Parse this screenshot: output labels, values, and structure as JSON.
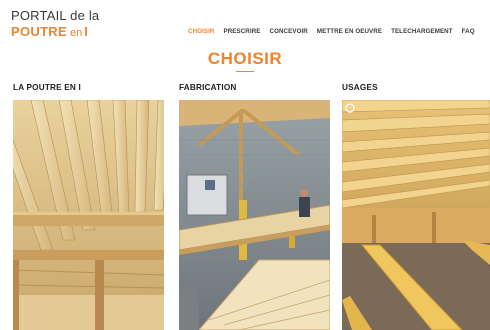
{
  "logo": {
    "line1": "PORTAIL de la",
    "bold": "POUTRE",
    "small": "en",
    "letter": "I"
  },
  "nav": {
    "items": [
      {
        "label": "CHOISIR",
        "active": true
      },
      {
        "label": "PRESCRIRE"
      },
      {
        "label": "CONCEVOIR"
      },
      {
        "label": "METTRE EN OEUVRE"
      },
      {
        "label": "TELECHARGEMENT"
      },
      {
        "label": "FAQ"
      }
    ]
  },
  "page": {
    "title": "CHOISIR"
  },
  "columns": [
    {
      "heading": "LA POUTRE EN I"
    },
    {
      "heading": "FABRICATION"
    },
    {
      "heading": "USAGES"
    }
  ],
  "colors": {
    "accent": "#f0832d",
    "text": "#3a3a3a"
  }
}
